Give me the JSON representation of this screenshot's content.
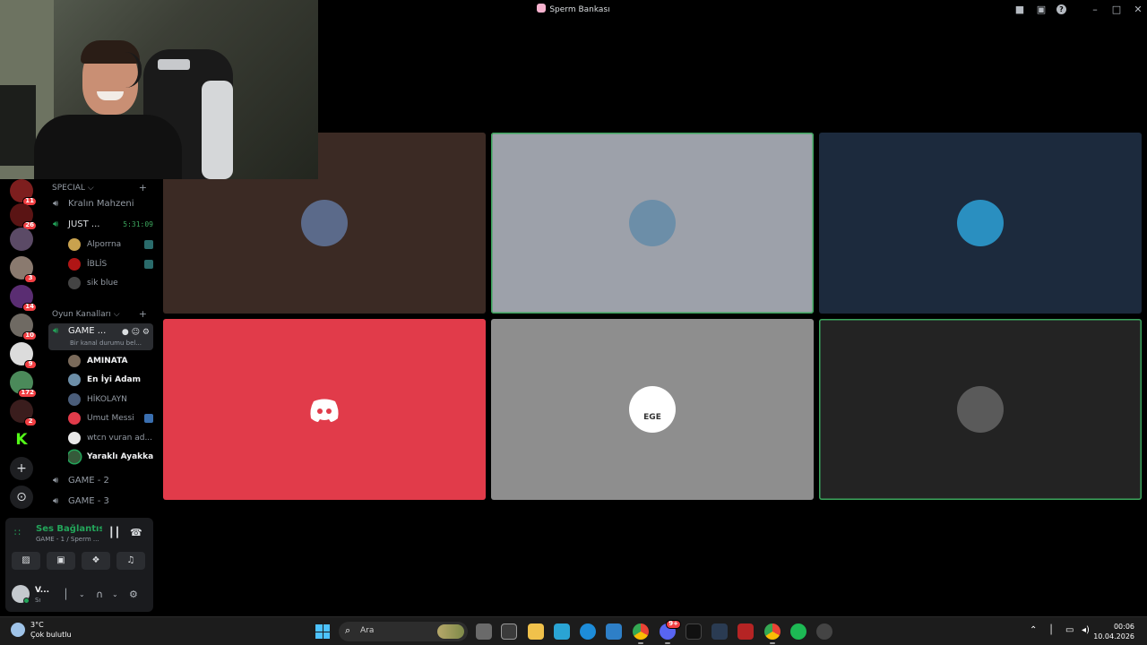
{
  "window": {
    "title": "Sperm Bankası"
  },
  "colors": {
    "speaking_outline": "#3ba55c",
    "unread_badge": "#f23f43",
    "connected_green": "#23a55a",
    "discord_red": "#e13b4a"
  },
  "rail": {
    "servers": [
      {
        "name": "server-1",
        "color": "#7d1e1e",
        "badge": "11"
      },
      {
        "name": "server-2",
        "color": "#5a1414",
        "badge": "26"
      },
      {
        "name": "server-3",
        "color": "#5b4a66",
        "badge": ""
      },
      {
        "name": "server-4",
        "color": "#8a7a6f",
        "badge": "3"
      },
      {
        "name": "server-5",
        "color": "#5a2d72",
        "badge": "14"
      },
      {
        "name": "server-6",
        "color": "#6f6a63",
        "badge": "10"
      },
      {
        "name": "server-7",
        "color": "#dcdcdc",
        "badge": "9"
      },
      {
        "name": "server-8",
        "color": "#4b8a5a",
        "badge": "172"
      },
      {
        "name": "server-9",
        "color": "#3a1d1d",
        "badge": "2"
      },
      {
        "name": "server-kick",
        "color": "#000000",
        "badge": "",
        "glyph": "K"
      }
    ],
    "add_icon": "plus-icon",
    "explore_icon": "compass-icon"
  },
  "sidebar": {
    "category_special": "SPECIAL",
    "channel_kralin": "Kralın Mahzeni",
    "channel_just": "JUST ...",
    "channel_just_timer": "5:31:09",
    "just_users": [
      {
        "name": "Alporrna",
        "color": "#c9a24e"
      },
      {
        "name": "İBLİS",
        "color": "#b01515"
      },
      {
        "name": "sik blue",
        "color": "#444"
      }
    ],
    "category_oyun": "Oyun Kanalları",
    "channel_game1": "GAME ...",
    "channel_game1_status": "Bir kanal durumu bel...",
    "game1_users": [
      {
        "name": "AMINATA",
        "bold": true,
        "color": "#7a6a5a"
      },
      {
        "name": "En İyi Adam",
        "bold": true,
        "color": "#6c8ea8"
      },
      {
        "name": "HİKOLAYN",
        "bold": false,
        "color": "#4a5d7a"
      },
      {
        "name": "Umut Messi",
        "bold": false,
        "color": "#e13b4a"
      },
      {
        "name": "wtcn vuran ad...",
        "bold": false,
        "color": "#e8e8e8"
      },
      {
        "name": "Yaraklı Ayakkab",
        "bold": true,
        "color": "#355a3a"
      }
    ],
    "channel_game2": "GAME - 2",
    "channel_game3": "GAME - 3"
  },
  "voice_panel": {
    "title": "Ses Bağlantısı Kuruldu",
    "subtitle": "GAME - 1 / Sperm ...",
    "user_name": "V...",
    "user_status": "Sı"
  },
  "tiles": [
    {
      "bg": "#3b2a24",
      "avatar": "#5b6a8a",
      "speaking": false
    },
    {
      "bg": "#9da1aa",
      "avatar": "#6c8ea8",
      "speaking": true
    },
    {
      "bg": "#1c2a3d",
      "avatar": "#2a8fc0",
      "speaking": false
    },
    {
      "bg": "#e13b4a",
      "avatar": "discord",
      "speaking": false
    },
    {
      "bg": "#8e8e8e",
      "avatar": "#ffffff",
      "speaking": false,
      "avatar_text": "EGE"
    },
    {
      "bg": "#232323",
      "avatar": "#5a5a5a",
      "speaking": true
    }
  ],
  "taskbar": {
    "weather_temp": "3°C",
    "weather_desc": "Çok bulutlu",
    "search_placeholder": "Ara",
    "discord_badge": "9+",
    "time": "00:06",
    "date": "10.04.2026"
  }
}
